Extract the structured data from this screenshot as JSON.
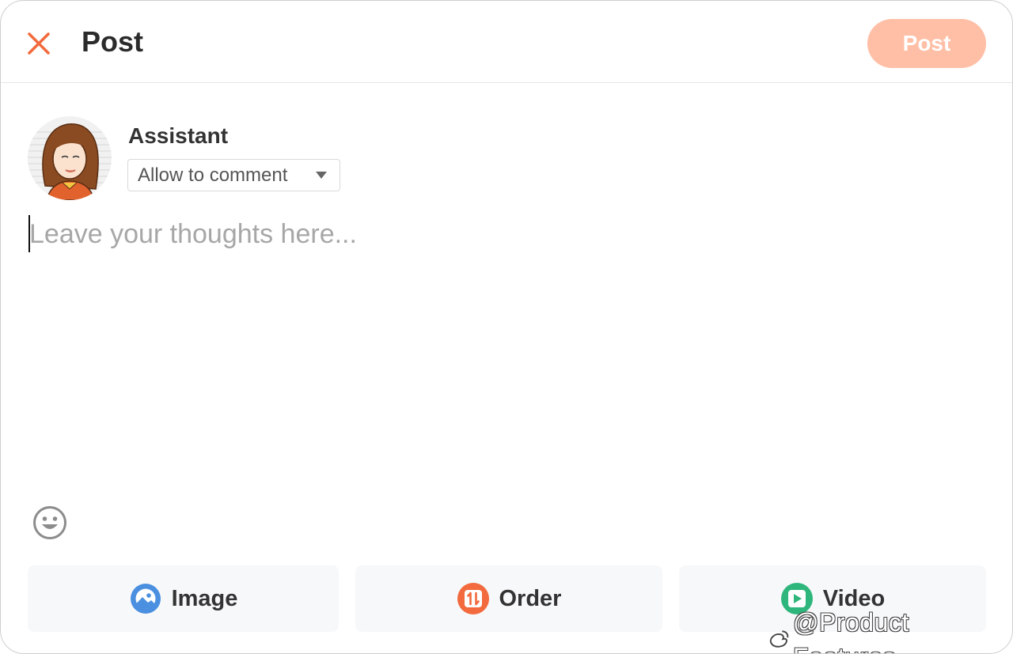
{
  "header": {
    "title": "Post",
    "post_label": "Post",
    "accent_color": "#f26a3d",
    "post_button_color": "#ffbfa6"
  },
  "user": {
    "name": "Assistant",
    "comment_option": "Allow to comment",
    "avatar_icon": "woman-avatar"
  },
  "composer": {
    "placeholder": "Leave your thoughts here...",
    "emoji_icon": "smiley-icon"
  },
  "actions": [
    {
      "label": "Image",
      "icon": "image-icon",
      "color": "#4a8fe0"
    },
    {
      "label": "Order",
      "icon": "order-icon",
      "color": "#f26a3d"
    },
    {
      "label": "Video",
      "icon": "video-icon",
      "color": "#2fb67c"
    }
  ],
  "watermark": "@Product Features"
}
